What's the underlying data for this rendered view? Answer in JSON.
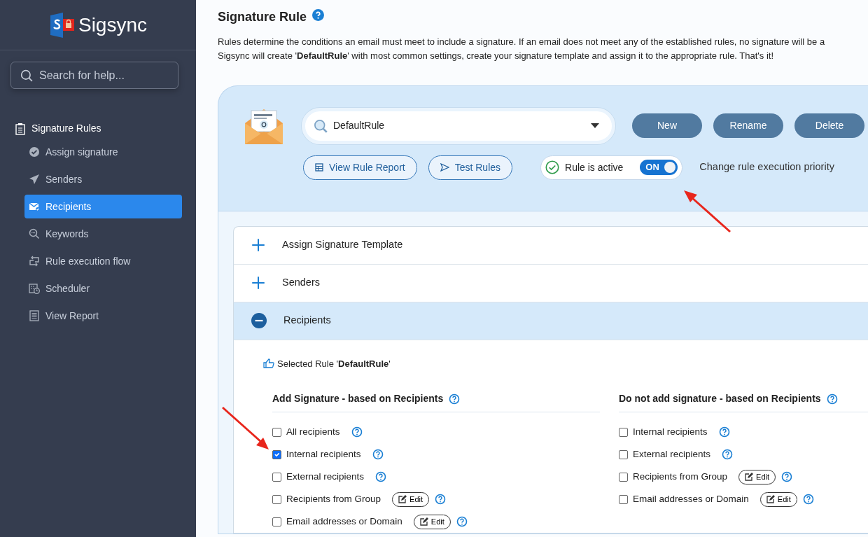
{
  "sidebar": {
    "logo": {
      "text": "Sigsync"
    },
    "search": {
      "placeholder": "Search for help..."
    },
    "section": {
      "label": "Signature Rules"
    },
    "items": [
      {
        "label": "Assign signature",
        "selected": false,
        "kind": "check"
      },
      {
        "label": "Senders",
        "selected": false,
        "kind": "send"
      },
      {
        "label": "Recipients",
        "selected": true,
        "kind": "mail"
      },
      {
        "label": "Keywords",
        "selected": false,
        "kind": "search"
      },
      {
        "label": "Rule execution flow",
        "selected": false,
        "kind": "flow"
      },
      {
        "label": "Scheduler",
        "selected": false,
        "kind": "calendar"
      },
      {
        "label": "View Report",
        "selected": false,
        "kind": "report"
      }
    ]
  },
  "page": {
    "title": "Signature Rule",
    "description_lines": [
      "Rules determine the conditions an email must meet to include a signature. If an email does not meet any of the established rules, no signature will be a",
      "Sigsync will create '**DefaultRule**' with most common settings, create your signature template and assign it to the appropriate rule. That's it!"
    ]
  },
  "rule_panel": {
    "rule_select": {
      "value": "DefaultRule"
    },
    "buttons": [
      "New",
      "Rename",
      "Delete"
    ],
    "view_report": "View Rule Report",
    "test_rules": "Test Rules",
    "active": {
      "label": "Rule is active",
      "on": true,
      "toggle_text": "ON"
    },
    "priority_link": "Change rule execution priority"
  },
  "accordion": [
    {
      "title": "Assign Signature Template",
      "expanded": false
    },
    {
      "title": "Senders",
      "expanded": false
    },
    {
      "title": "Recipients",
      "expanded": true
    }
  ],
  "recipients": {
    "selected_rule": "Selected Rule '**DefaultRule**'",
    "columns": [
      {
        "heading": "Add Signature - based on Recipients",
        "options": [
          {
            "label": "All recipients",
            "checked": false
          },
          {
            "label": "Internal recipients",
            "checked": true
          },
          {
            "label": "External recipients",
            "checked": false
          },
          {
            "label": "Recipients from Group",
            "checked": false,
            "edit_label": "Edit"
          },
          {
            "label": "Email addresses or Domain",
            "checked": false,
            "edit_label": "Edit"
          }
        ]
      },
      {
        "heading": "Do not add signature - based on Recipients",
        "options": [
          {
            "label": "Internal recipients",
            "checked": false
          },
          {
            "label": "External recipients",
            "checked": false
          },
          {
            "label": "Recipients from Group",
            "checked": false,
            "edit_label": "Edit"
          },
          {
            "label": "Email addresses or Domain",
            "checked": false,
            "edit_label": "Edit"
          }
        ]
      }
    ]
  }
}
